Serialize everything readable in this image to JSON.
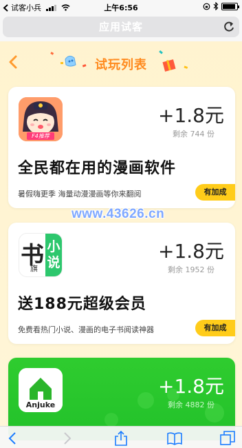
{
  "status_bar": {
    "carrier": "试客小兵",
    "time": "上午6:56"
  },
  "address_bar": {
    "title": "应用试客"
  },
  "header": {
    "title": "试玩列表"
  },
  "tasks": [
    {
      "reward": "+1.8元",
      "remaining": "剩余 744 份",
      "title": "全民都在用的漫画软件",
      "description": "暑假嗨更季 海量动漫漫画等你来翻阅",
      "tag": "有加成",
      "icon_badge": "F4推荐"
    },
    {
      "reward": "+1.8元",
      "remaining": "剩余 1952 份",
      "title": "送188元超级会员",
      "description": "免费看热门小说、漫画的电子书阅读神器",
      "tag": "有加成",
      "icon_text_1": "书",
      "icon_text_2": "小说",
      "icon_text_3": "旗"
    },
    {
      "reward": "+1.8元",
      "remaining": "剩余 4882 份",
      "icon_text": "Anjuke"
    }
  ],
  "watermark": "www.43626.cn",
  "colors": {
    "accent": "#ff8a1e",
    "tag": "#ffcc1a",
    "card3": "#2fcc2f"
  },
  "toolbar": {
    "icons": [
      "back-icon",
      "forward-icon",
      "share-icon",
      "bookmarks-icon",
      "tabs-icon"
    ]
  }
}
